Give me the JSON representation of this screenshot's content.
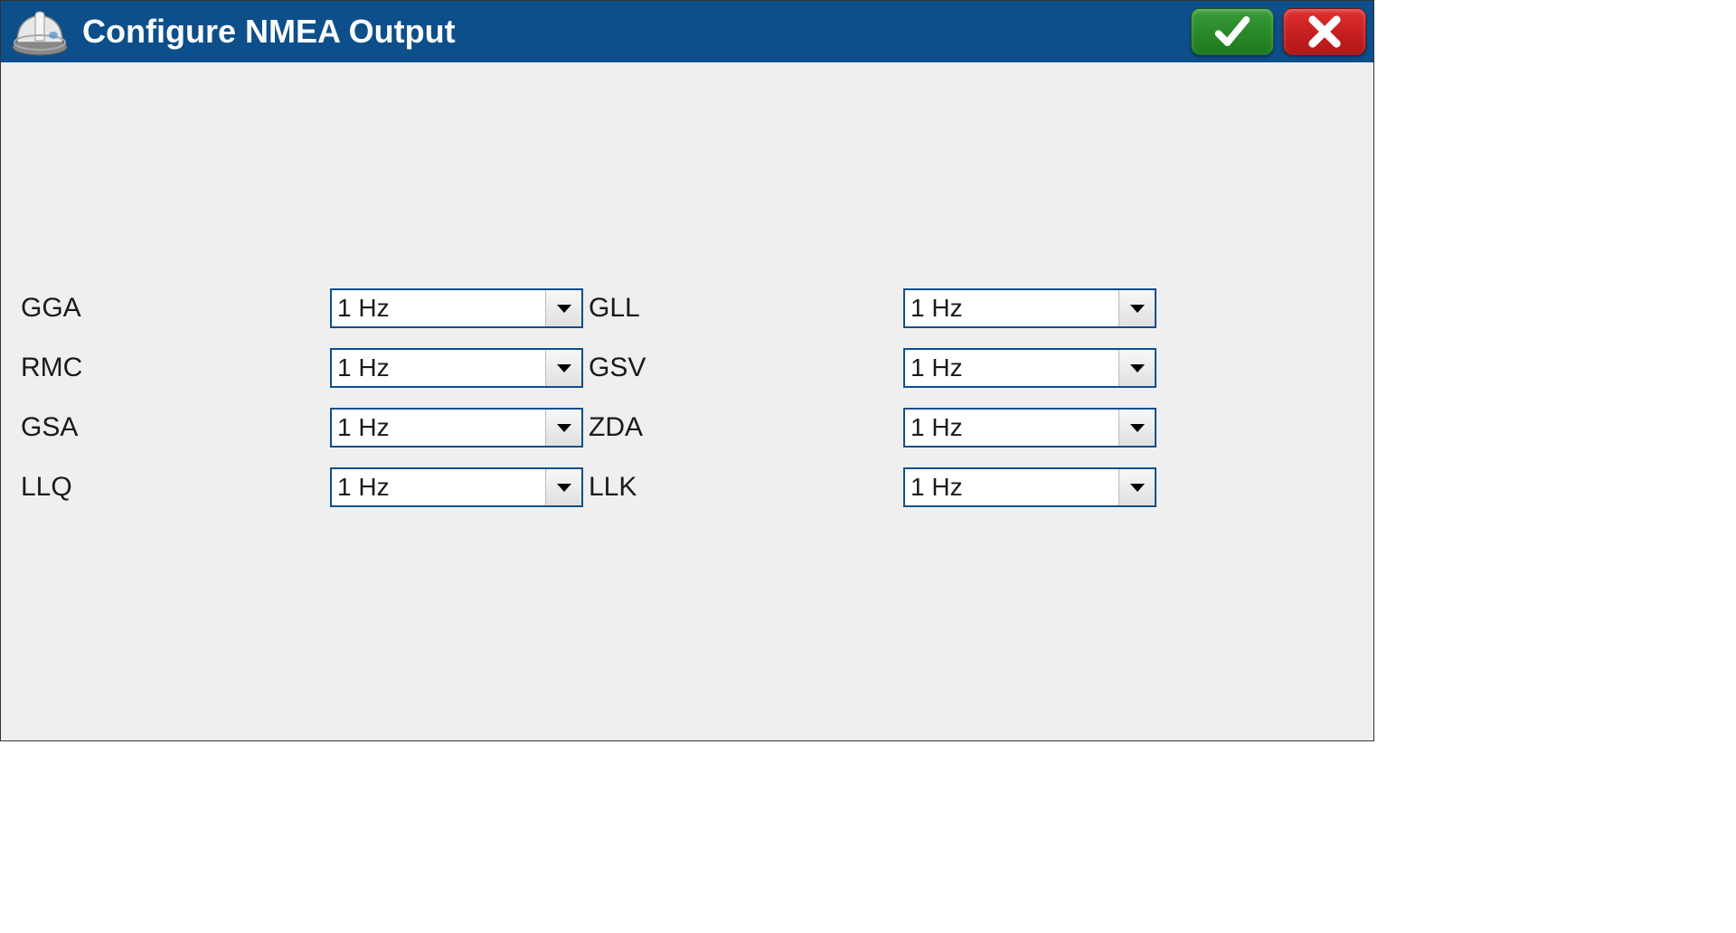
{
  "header": {
    "title": "Configure NMEA Output"
  },
  "rows": [
    {
      "leftLabel": "GGA",
      "leftValue": "1 Hz",
      "rightLabel": "GLL",
      "rightValue": "1 Hz"
    },
    {
      "leftLabel": "RMC",
      "leftValue": "1 Hz",
      "rightLabel": "GSV",
      "rightValue": "1 Hz"
    },
    {
      "leftLabel": "GSA",
      "leftValue": "1 Hz",
      "rightLabel": "ZDA",
      "rightValue": "1 Hz"
    },
    {
      "leftLabel": "LLQ",
      "leftValue": "1 Hz",
      "rightLabel": "LLK",
      "rightValue": "1 Hz"
    }
  ]
}
